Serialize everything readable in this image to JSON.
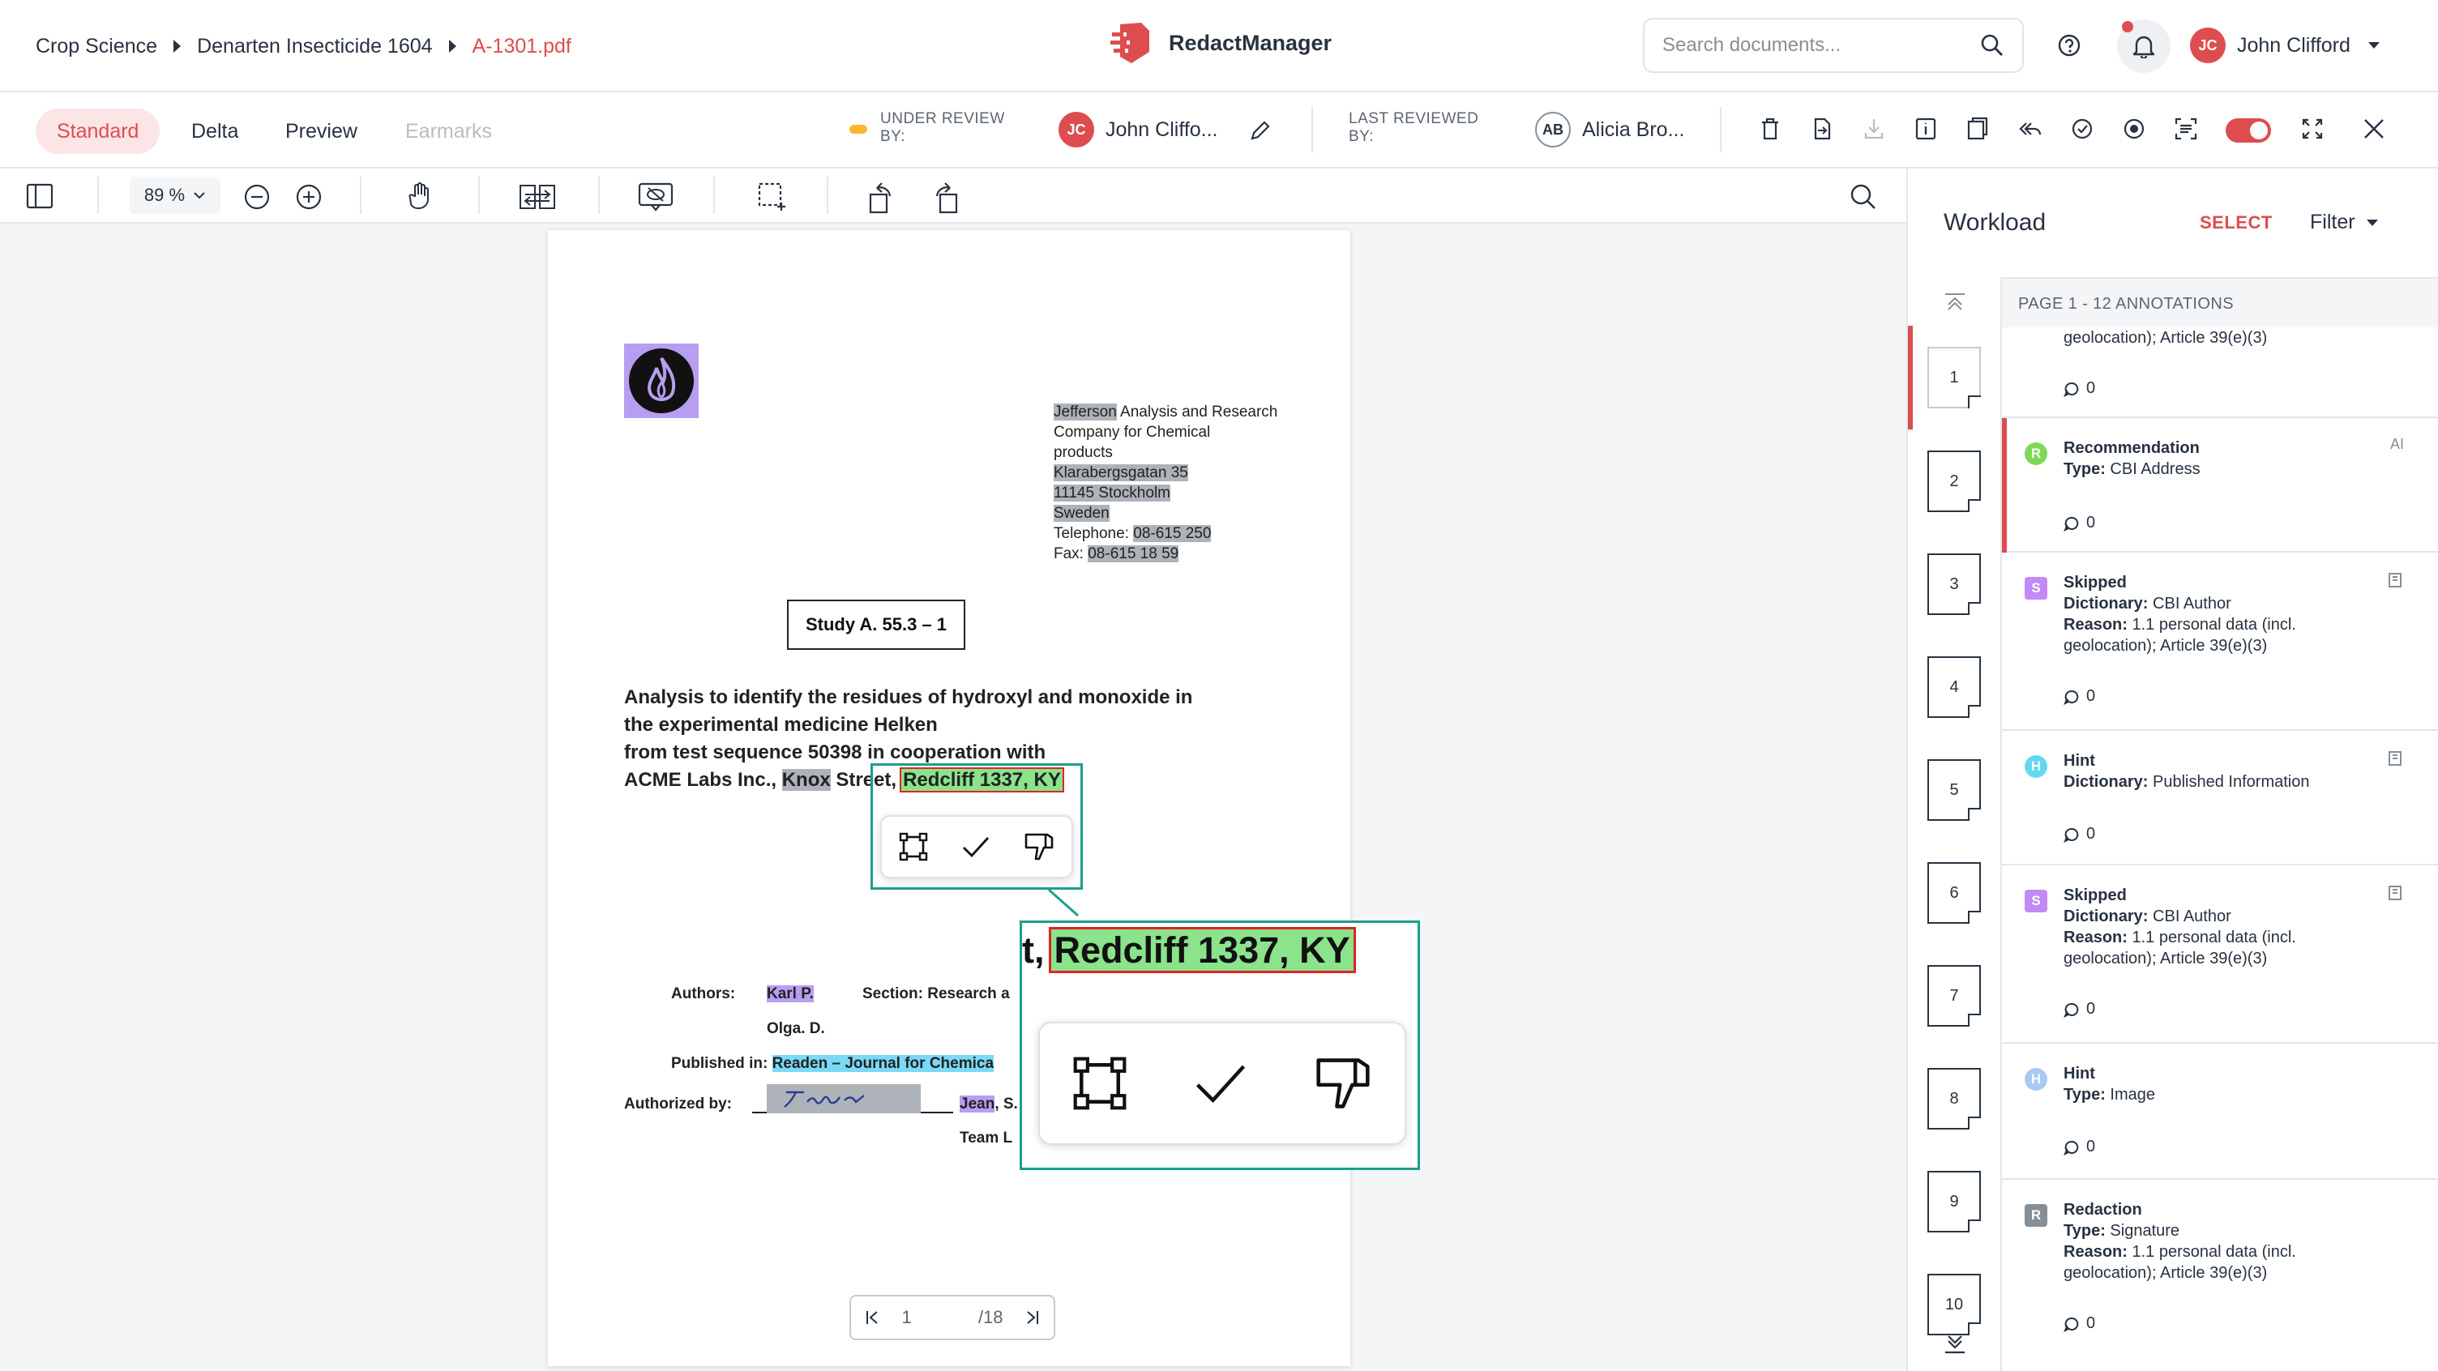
{
  "breadcrumb": {
    "items": [
      "Crop Science",
      "Denarten Insecticide 1604"
    ],
    "current": "A-1301.pdf"
  },
  "app": {
    "name": "RedactManager"
  },
  "search": {
    "placeholder": "Search documents..."
  },
  "user": {
    "initials": "JC",
    "name": "John Clifford"
  },
  "tabs": [
    {
      "label": "Standard",
      "state": "active"
    },
    {
      "label": "Delta",
      "state": "normal"
    },
    {
      "label": "Preview",
      "state": "normal"
    },
    {
      "label": "Earmarks",
      "state": "disabled"
    }
  ],
  "review": {
    "under_review_label": "UNDER REVIEW\nBY:",
    "reviewer_initials": "JC",
    "reviewer_name": "John Cliffo...",
    "last_reviewed_label": "LAST REVIEWED\nBY:",
    "last_initials": "AB",
    "last_name": "Alicia Bro..."
  },
  "toolbar": {
    "zoom": "89 %"
  },
  "document": {
    "address": [
      {
        "hl": "Jefferson",
        "text": " Analysis and Research"
      },
      {
        "hl": "",
        "text": "Company for Chemical"
      },
      {
        "hl": "",
        "text": "products"
      },
      {
        "hl": "Klarabergsgatan 35",
        "text": ""
      },
      {
        "hl": "11145 Stockholm",
        "text": ""
      },
      {
        "hl": "Sweden",
        "text": ""
      },
      {
        "label": "Telephone: ",
        "hl": "08-615 250"
      },
      {
        "label": "Fax: ",
        "hl": "08-615 18 59"
      }
    ],
    "study_box": "Study A. 55.3 – 1",
    "title_lines": [
      "Analysis to identify the residues of hydroxyl and monoxide in",
      "the experimental medicine Helken",
      "from test sequence 50398 in cooperation with"
    ],
    "title_last_prefix": "ACME Labs Inc., ",
    "title_last_knox": "Knox",
    "title_last_street": " Street,",
    "title_last_redact": "Redcliff 1337, KY",
    "authors_label": "Authors:",
    "author_1": "Karl P.",
    "author_2": "Olga. D.",
    "section_label": "Section: Research a",
    "published_label": "Published in: ",
    "published_value": "Readen – Journal for Chemica",
    "authorized_label": "Authorized by:",
    "jean": "Jean",
    "jean_suffix": ", S.",
    "team": "Team L",
    "callout_prefix": "t,",
    "callout_value": "Redcliff 1337, KY"
  },
  "paginator": {
    "current": "1",
    "total": "/18"
  },
  "workload": {
    "title": "Workload",
    "select_label": "SELECT",
    "filter_label": "Filter",
    "page_header": "PAGE 1 - 12 ANNOTATIONS",
    "thumbs": [
      "1",
      "2",
      "3",
      "4",
      "5",
      "6",
      "7",
      "8",
      "9",
      "10"
    ],
    "annotations": [
      {
        "lines": [
          [
            "",
            "geolocation); Article 39(e)(3)"
          ]
        ],
        "comments": "0",
        "tag": "",
        "tag_color": "",
        "badge": ""
      },
      {
        "title": "Recommendation",
        "lines": [
          [
            "Type: ",
            "CBI Address"
          ]
        ],
        "comments": "0",
        "tag": "R",
        "tag_color": "#7ed957",
        "badge": "AI"
      },
      {
        "title": "Skipped",
        "lines": [
          [
            "Dictionary: ",
            "CBI Author"
          ],
          [
            "Reason: ",
            "1.1 personal data (incl."
          ],
          [
            "",
            "geolocation); Article 39(e)(3)"
          ]
        ],
        "comments": "0",
        "tag": "S",
        "tag_color": "#c38af5",
        "badge": "icon"
      },
      {
        "title": "Hint",
        "lines": [
          [
            "Dictionary: ",
            "Published Information"
          ]
        ],
        "comments": "0",
        "tag": "H",
        "tag_color": "#64d8f2",
        "badge": "icon"
      },
      {
        "title": "Skipped",
        "lines": [
          [
            "Dictionary: ",
            "CBI Author"
          ],
          [
            "Reason: ",
            "1.1 personal data (incl."
          ],
          [
            "",
            "geolocation); Article 39(e)(3)"
          ]
        ],
        "comments": "0",
        "tag": "S",
        "tag_color": "#c38af5",
        "badge": "icon"
      },
      {
        "title": "Hint",
        "lines": [
          [
            "Type: ",
            "Image"
          ]
        ],
        "comments": "0",
        "tag": "H",
        "tag_color": "#a9c8f5",
        "badge": ""
      },
      {
        "title": "Redaction",
        "lines": [
          [
            "Type: ",
            "Signature"
          ],
          [
            "Reason: ",
            "1.1 personal data (incl."
          ],
          [
            "",
            "geolocation); Article 39(e)(3)"
          ]
        ],
        "comments": "0",
        "tag": "R",
        "tag_color": "#868e96",
        "badge": ""
      }
    ]
  },
  "colors": {
    "accent": "#dd4d50",
    "callout": "#1aa08a",
    "text": "#283241"
  }
}
